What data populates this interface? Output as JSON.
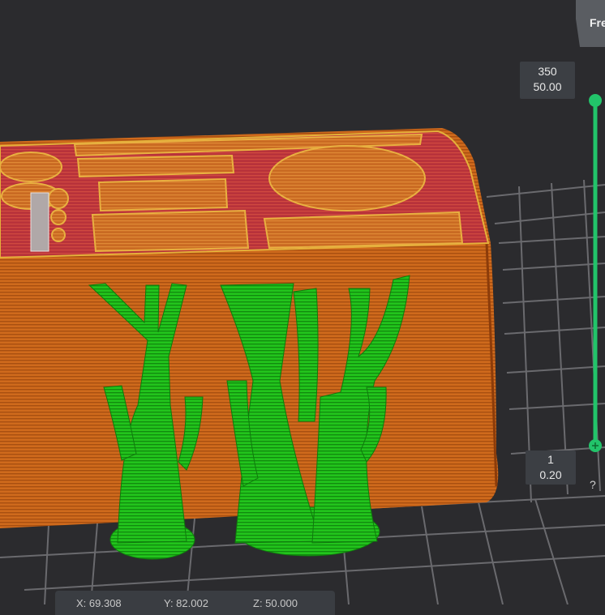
{
  "view_mode_tab": "Fre",
  "layer_slider": {
    "top_layer": "350",
    "top_height": "50.00",
    "bottom_layer": "1",
    "bottom_height": "0.20"
  },
  "help_label": "?",
  "coords": {
    "x": "X: 69.308",
    "y": "Y: 82.002",
    "z": "Z: 50.000"
  },
  "colors": {
    "background": "#2b2b2e",
    "bed_grid": "#6a6a6e",
    "perimeter": "#d06a1a",
    "top_infill": "#b8323a",
    "support": "#22c41c",
    "slider": "#22c46a"
  }
}
